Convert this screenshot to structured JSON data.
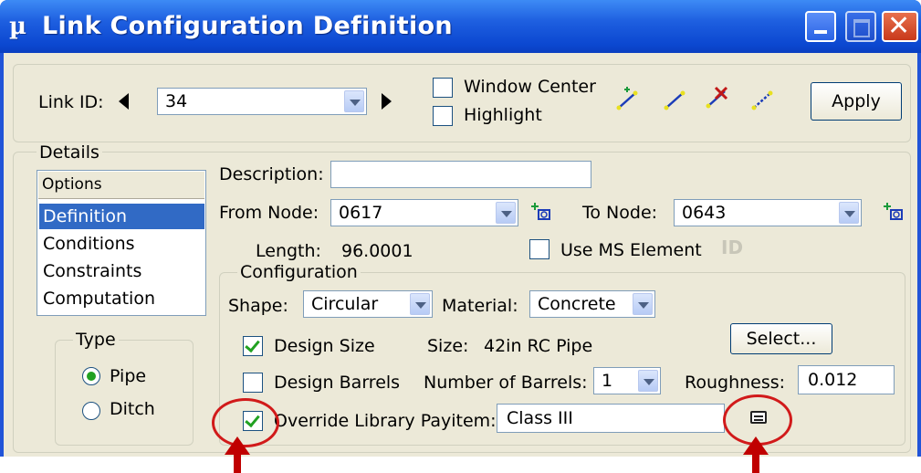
{
  "window": {
    "title": "Link Configuration Definition",
    "icon": "app-icon"
  },
  "header": {
    "link_id_label": "Link ID:",
    "link_id_value": "34",
    "window_center_label": "Window Center",
    "window_center_checked": false,
    "highlight_label": "Highlight",
    "highlight_checked": false,
    "apply_label": "Apply",
    "tool_icons": [
      "add-link-icon",
      "select-link-icon",
      "delete-link-icon",
      "edit-link-icon"
    ]
  },
  "details": {
    "group_label": "Details",
    "options_header": "Options",
    "options": [
      "Definition",
      "Conditions",
      "Constraints",
      "Computation"
    ],
    "selected_option": "Definition",
    "type_group_label": "Type",
    "type_options": [
      "Pipe",
      "Ditch"
    ],
    "type_selected": "Pipe",
    "description_label": "Description:",
    "description_value": "",
    "from_node_label": "From Node:",
    "from_node_value": "0617",
    "to_node_label": "To Node:",
    "to_node_value": "0643",
    "length_label": "Length:",
    "length_value": "96.0001",
    "use_ms_element_label": "Use MS Element",
    "use_ms_element_checked": false
  },
  "configuration": {
    "group_label": "Configuration",
    "shape_label": "Shape:",
    "shape_value": "Circular",
    "material_label": "Material:",
    "material_value": "Concrete",
    "design_size_label": "Design Size",
    "design_size_checked": true,
    "size_label": "Size:",
    "size_value": "42in RC Pipe",
    "select_label": "Select...",
    "design_barrels_label": "Design Barrels",
    "design_barrels_checked": false,
    "num_barrels_label": "Number of Barrels:",
    "num_barrels_value": "1",
    "roughness_label": "Roughness:",
    "roughness_value": "0.012",
    "override_label": "Override Library Payitem:",
    "override_checked": true,
    "payitem_value": "Class III"
  },
  "colors": {
    "titlebar": "#0b47d0",
    "client": "#ece9d8",
    "selection": "#316ac5",
    "annotation": "#d11a1a"
  }
}
